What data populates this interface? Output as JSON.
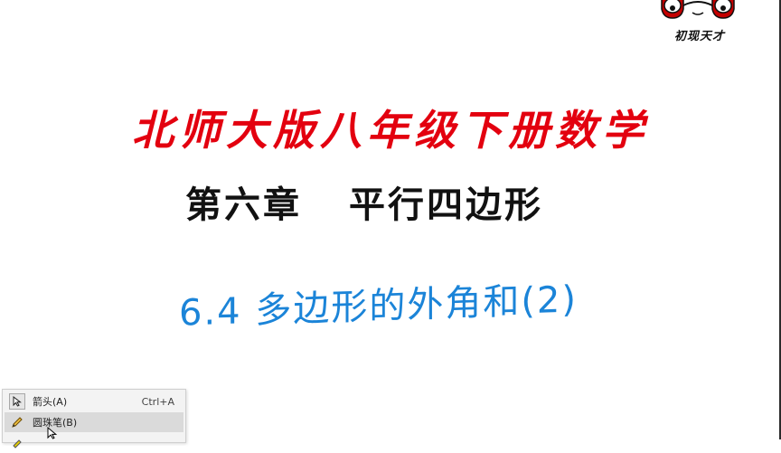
{
  "logo": {
    "text": "初现天才",
    "icon": "glasses-logo-icon",
    "colors": {
      "frame": "#c40000",
      "lens": "#ffffff",
      "outline": "#111111"
    }
  },
  "slide": {
    "title": "北师大版八年级下册数学",
    "chapter": {
      "part1": "第六章",
      "part2": "平行四边形"
    },
    "section": "6.4 多边形的外角和(2)",
    "colors": {
      "title": "#e3000f",
      "chapter": "#111111",
      "section": "#1b84d8"
    }
  },
  "context_menu": {
    "items": [
      {
        "label": "箭头(A)",
        "shortcut": "Ctrl+A",
        "icon": "arrow-pointer-icon"
      },
      {
        "label": "圆珠笔(B)",
        "shortcut": "",
        "icon": "pen-icon",
        "highlighted": true
      },
      {
        "label": "",
        "shortcut": "",
        "icon": "highlighter-icon"
      }
    ]
  }
}
